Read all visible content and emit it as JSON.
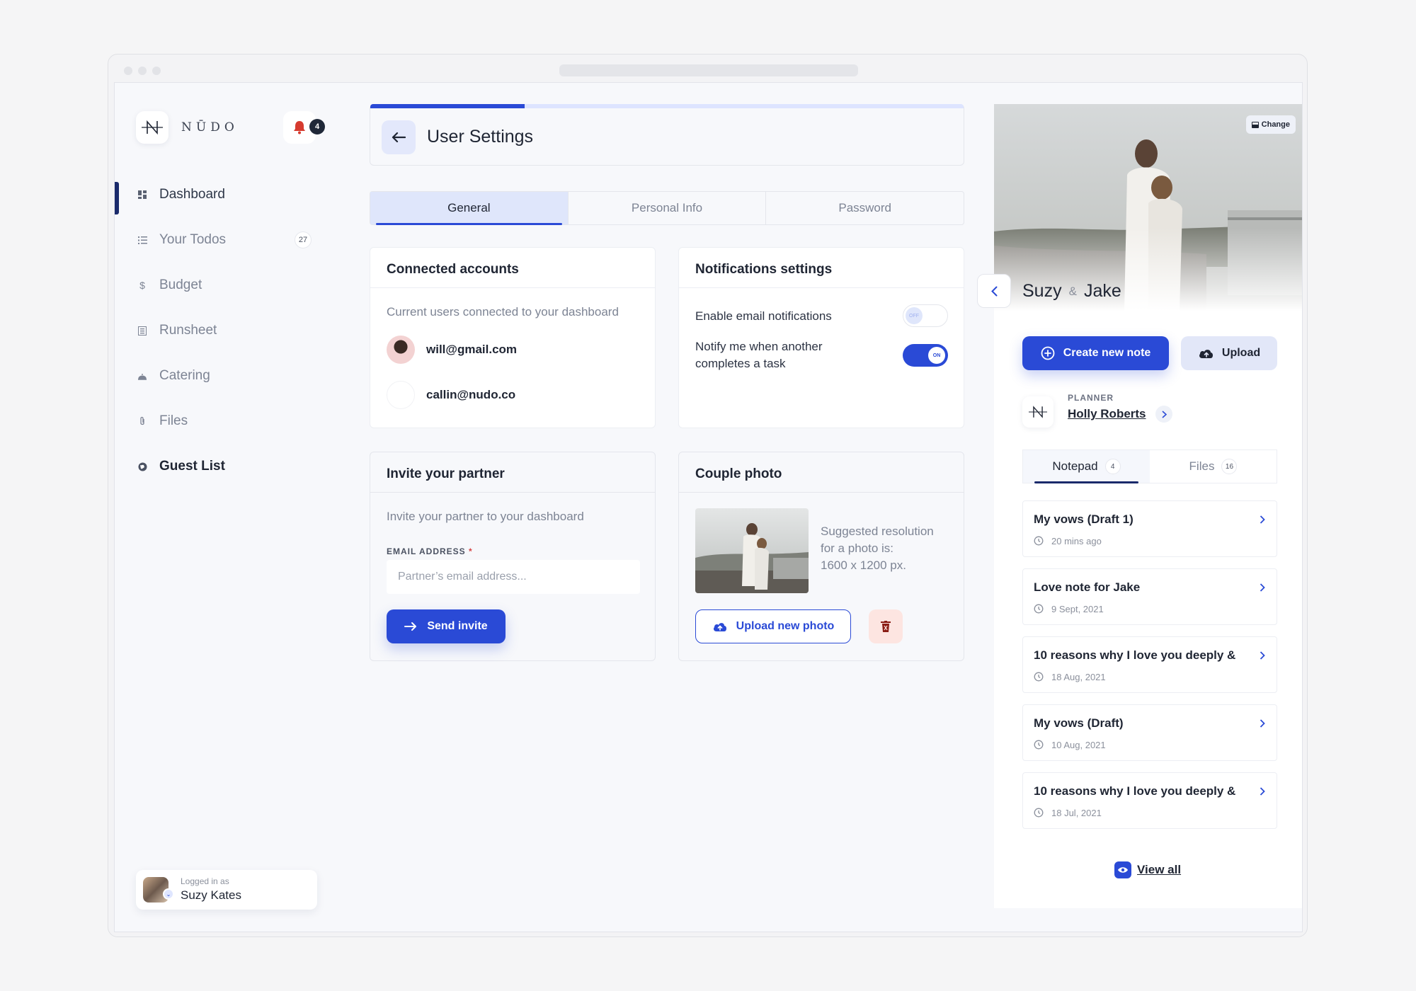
{
  "brand": {
    "logo_letter": "N",
    "name": "NŪDO"
  },
  "notifications": {
    "count": "4"
  },
  "sidebar": {
    "items": [
      {
        "label": "Dashboard",
        "icon": "dashboard-icon",
        "state": "active"
      },
      {
        "label": "Your Todos",
        "icon": "list-icon",
        "count": "27"
      },
      {
        "label": "Budget",
        "icon": "dollar-icon"
      },
      {
        "label": "Runsheet",
        "icon": "runsheet-icon"
      },
      {
        "label": "Catering",
        "icon": "catering-icon"
      },
      {
        "label": "Files",
        "icon": "paperclip-icon"
      },
      {
        "label": "Guest List",
        "icon": "globe-icon",
        "state": "bold"
      }
    ],
    "logged_in": {
      "label": "Logged in as",
      "name": "Suzy Kates"
    }
  },
  "header": {
    "title": "User Settings",
    "progress_percent": 26
  },
  "tabs": [
    {
      "label": "General",
      "active": true
    },
    {
      "label": "Personal Info",
      "active": false
    },
    {
      "label": "Password",
      "active": false
    }
  ],
  "connected_accounts": {
    "title": "Connected accounts",
    "subtitle": "Current users connected to your dashboard",
    "accounts": [
      "will@gmail.com",
      "callin@nudo.co"
    ]
  },
  "notifications_settings": {
    "title": "Notifications settings",
    "items": [
      {
        "label": "Enable email notifications",
        "state": "OFF"
      },
      {
        "label_line1": "Notify me when another",
        "label_line2": "completes a task",
        "state": "ON"
      }
    ]
  },
  "invite": {
    "title": "Invite your partner",
    "subtitle": "Invite your partner to your dashboard",
    "field_label": "EMAIL ADDRESS",
    "required_mark": "*",
    "placeholder": "Partner’s email address...",
    "value": "",
    "button": "Send invite"
  },
  "couple_photo": {
    "title": "Couple photo",
    "hint_line1": "Suggested resolution",
    "hint_line2": "for a photo is:",
    "hint_line3": "1600 x 1200 px.",
    "upload_button": "Upload new photo"
  },
  "right_panel": {
    "change_label": "Change",
    "name1": "Suzy",
    "amp": "&",
    "name2": "Jake",
    "create_note": "Create new note",
    "upload": "Upload",
    "planner_label": "PLANNER",
    "planner_name": "Holly Roberts",
    "tabs": [
      {
        "label": "Notepad",
        "count": "4",
        "active": true
      },
      {
        "label": "Files",
        "count": "16",
        "active": false
      }
    ],
    "notes": [
      {
        "title": "My vows (Draft 1)",
        "date": "20 mins ago"
      },
      {
        "title": "Love note for Jake",
        "date": "9 Sept, 2021"
      },
      {
        "title": "10 reasons why I love you deeply &",
        "date": "18 Aug, 2021"
      },
      {
        "title": "My vows (Draft)",
        "date": "10 Aug, 2021"
      },
      {
        "title": "10 reasons why I love you deeply &",
        "date": "18 Jul, 2021"
      }
    ],
    "view_all": "View all"
  },
  "colors": {
    "accent": "#2a4ad6",
    "navy": "#1a2a6b",
    "danger": "#d64545"
  }
}
